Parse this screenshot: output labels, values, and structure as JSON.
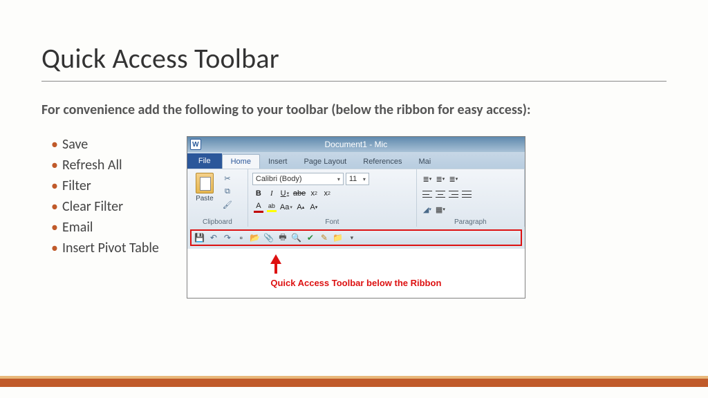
{
  "title": "Quick Access Toolbar",
  "intro": "For convenience add the following to your toolbar (below the ribbon for easy access):",
  "bullets": [
    "Save",
    "Refresh All",
    "Filter",
    "Clear Filter",
    "Email",
    "Insert Pivot Table"
  ],
  "word": {
    "doc_title": "Document1 - Mic",
    "app_letter": "W",
    "tabs": {
      "file": "File",
      "home": "Home",
      "insert": "Insert",
      "layout": "Page Layout",
      "refs": "References",
      "mail": "Mai"
    },
    "groups": {
      "clipboard": "Clipboard",
      "font": "Font",
      "paragraph": "Paragraph"
    },
    "paste": "Paste",
    "font_name": "Calibri (Body)",
    "font_size": "11",
    "caption": "Quick Access Toolbar below the Ribbon"
  }
}
